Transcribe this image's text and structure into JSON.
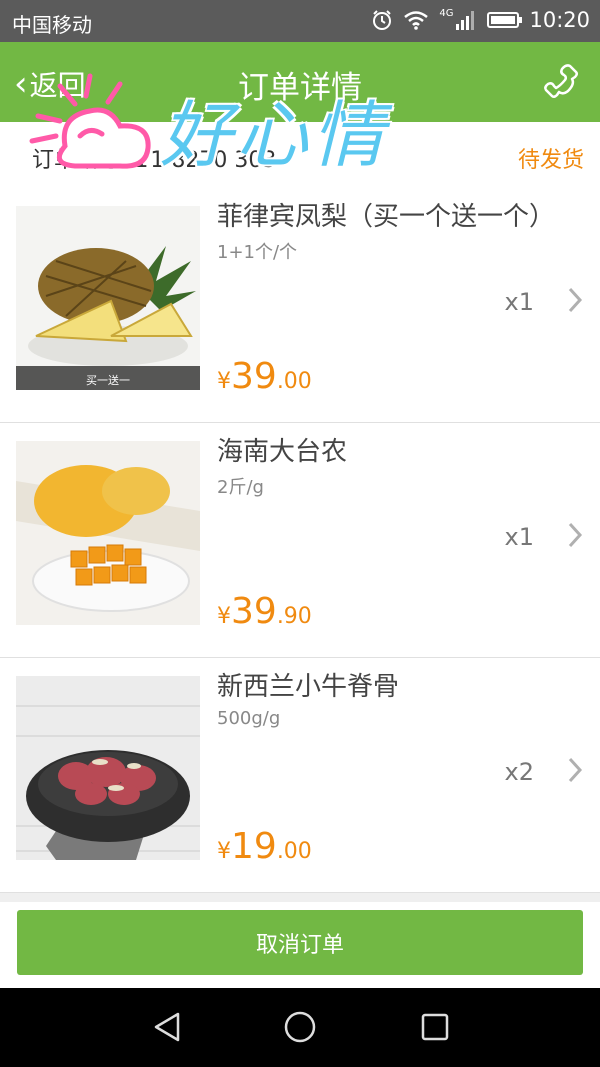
{
  "status_bar": {
    "carrier": "中国移动",
    "network": "4G",
    "time": "10:20",
    "icons": [
      "alarm-icon",
      "wifi-icon",
      "signal-icon",
      "battery-icon"
    ]
  },
  "nav": {
    "back_label": "返回",
    "title": "订单详情",
    "phone_icon": "phone-icon"
  },
  "order": {
    "number_label": "订单编号: 1",
    "number_partial": "1   8270   303",
    "status": "待发货"
  },
  "products": [
    {
      "name": "菲律宾凤梨（买一个送一个）",
      "spec": "1+1个/个",
      "quantity": "x1",
      "price_symbol": "¥",
      "price_int": "39",
      "price_dec": ".00",
      "image_badge": "买一送一"
    },
    {
      "name": "海南大台农",
      "spec": "2斤/g",
      "quantity": "x1",
      "price_symbol": "¥",
      "price_int": "39",
      "price_dec": ".90"
    },
    {
      "name": "新西兰小牛脊骨",
      "spec": "500g/g",
      "quantity": "x2",
      "price_symbol": "¥",
      "price_int": "19",
      "price_dec": ".00"
    }
  ],
  "action": {
    "cancel_label": "取消订单"
  },
  "watermark": {
    "text": "好心情"
  },
  "colors": {
    "primary_green": "#72b844",
    "accent_orange": "#f08a10",
    "status_bar_gray": "#5b5b5b"
  }
}
